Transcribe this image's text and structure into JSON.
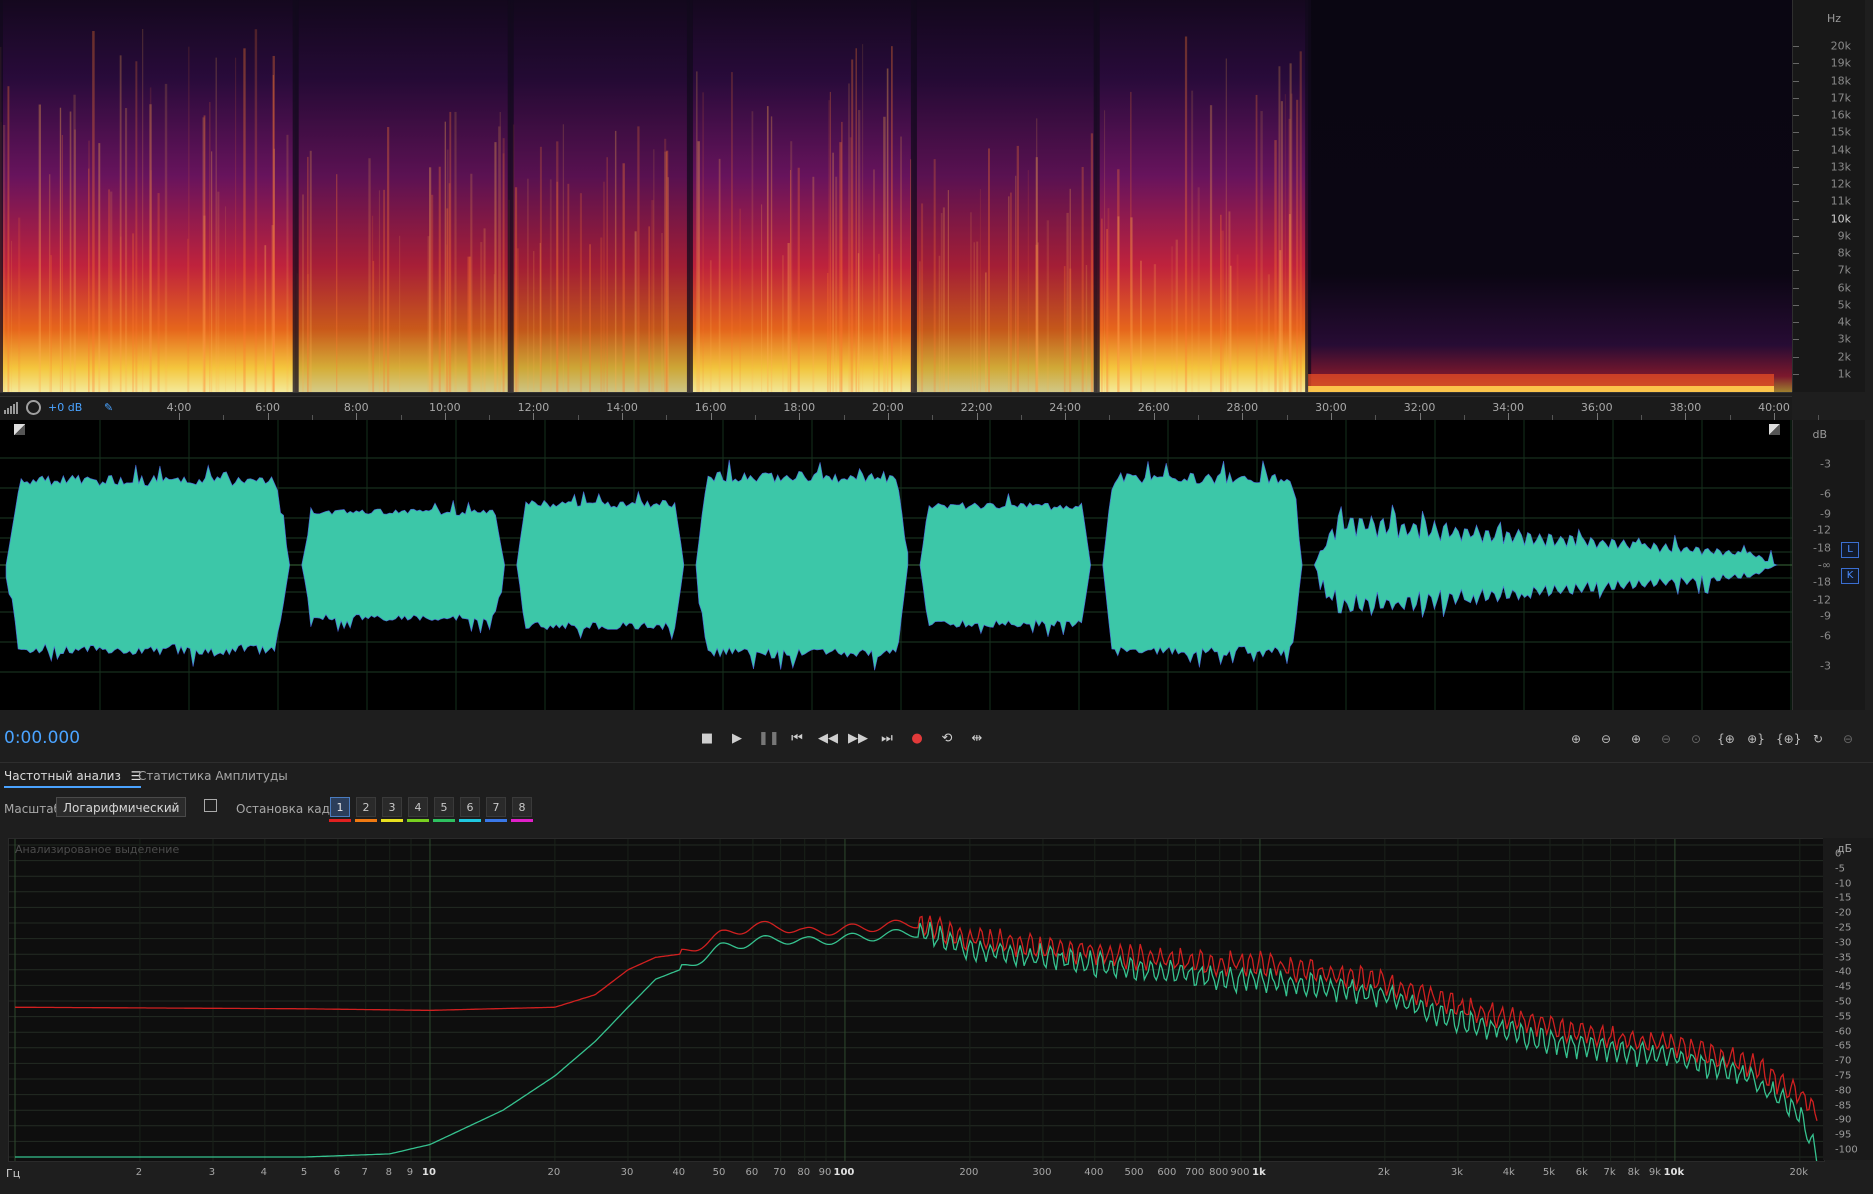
{
  "spectral": {
    "hz_unit": "Hz",
    "hz_labels": [
      "20k",
      "19k",
      "18k",
      "17k",
      "16k",
      "15k",
      "14k",
      "13k",
      "12k",
      "11k",
      "10k",
      "9k",
      "8k",
      "7k",
      "6k",
      "5k",
      "4k",
      "3k",
      "2k",
      "1k"
    ],
    "bright_label": "10k",
    "segments": [
      {
        "start": 0.0,
        "end": 0.165,
        "energy": 0.9
      },
      {
        "start": 0.165,
        "end": 0.285,
        "energy": 0.62
      },
      {
        "start": 0.285,
        "end": 0.385,
        "energy": 0.55
      },
      {
        "start": 0.385,
        "end": 0.51,
        "energy": 0.88
      },
      {
        "start": 0.51,
        "end": 0.612,
        "energy": 0.58
      },
      {
        "start": 0.612,
        "end": 0.73,
        "energy": 0.9
      },
      {
        "start": 0.73,
        "end": 1.0,
        "energy": 0.12
      }
    ]
  },
  "time_ruler": {
    "gain_label": "+0 dB",
    "ticks": [
      "4:00",
      "6:00",
      "8:00",
      "10:00",
      "12:00",
      "14:00",
      "16:00",
      "18:00",
      "20:00",
      "22:00",
      "24:00",
      "26:00",
      "28:00",
      "30:00",
      "32:00",
      "34:00",
      "36:00",
      "38:00",
      "40:00"
    ]
  },
  "waveform": {
    "color": "#3cc7a8",
    "db_unit": "dB",
    "db_labels_top": [
      "-3",
      "-6",
      "-9",
      "-12",
      "-18",
      "-∞"
    ],
    "db_labels_bottom": [
      "-18",
      "-12",
      "-9",
      "-6",
      "-3"
    ],
    "channel_left": "L",
    "channel_right": "K"
  },
  "transport": {
    "time": "0:00.000",
    "record_color": "#e23a3a"
  },
  "tabs": {
    "frequency": "Частотный анализ",
    "amplitude": "Статистика Амплитуды"
  },
  "controls": {
    "scale_label": "Масштаб:",
    "scale_value": "Логарифмический",
    "freeze_label": "Остановка кадра:",
    "frames": [
      "1",
      "2",
      "3",
      "4",
      "5",
      "6",
      "7",
      "8"
    ],
    "frame_colors": [
      "#e02020",
      "#f07a12",
      "#e8e020",
      "#78d020",
      "#2ec060",
      "#20c8e0",
      "#3a78e8",
      "#e020c8"
    ]
  },
  "freq_analysis": {
    "subtitle": "Анализированое выделение",
    "db_unit": "дБ",
    "db_labels": [
      "0",
      "-5",
      "-10",
      "-15",
      "-20",
      "-25",
      "-30",
      "-35",
      "-40",
      "-45",
      "-50",
      "-55",
      "-60",
      "-65",
      "-70",
      "-75",
      "-80",
      "-85",
      "-90",
      "-95",
      "-100"
    ],
    "hz_unit": "Гц",
    "hz_labels": [
      {
        "v": 2,
        "t": "2"
      },
      {
        "v": 3,
        "t": "3"
      },
      {
        "v": 4,
        "t": "4"
      },
      {
        "v": 5,
        "t": "5"
      },
      {
        "v": 6,
        "t": "6"
      },
      {
        "v": 7,
        "t": "7"
      },
      {
        "v": 8,
        "t": "8"
      },
      {
        "v": 9,
        "t": "9"
      },
      {
        "v": 10,
        "t": "10",
        "bold": true
      },
      {
        "v": 20,
        "t": "20"
      },
      {
        "v": 30,
        "t": "30"
      },
      {
        "v": 40,
        "t": "40"
      },
      {
        "v": 50,
        "t": "50"
      },
      {
        "v": 60,
        "t": "60"
      },
      {
        "v": 70,
        "t": "70"
      },
      {
        "v": 80,
        "t": "80"
      },
      {
        "v": 90,
        "t": "90"
      },
      {
        "v": 100,
        "t": "100",
        "bold": true
      },
      {
        "v": 200,
        "t": "200"
      },
      {
        "v": 300,
        "t": "300"
      },
      {
        "v": 400,
        "t": "400"
      },
      {
        "v": 500,
        "t": "500"
      },
      {
        "v": 600,
        "t": "600"
      },
      {
        "v": 700,
        "t": "700"
      },
      {
        "v": 800,
        "t": "800"
      },
      {
        "v": 900,
        "t": "900"
      },
      {
        "v": 1000,
        "t": "1k",
        "bold": true
      },
      {
        "v": 2000,
        "t": "2k"
      },
      {
        "v": 3000,
        "t": "3k"
      },
      {
        "v": 4000,
        "t": "4k"
      },
      {
        "v": 5000,
        "t": "5k"
      },
      {
        "v": 6000,
        "t": "6k"
      },
      {
        "v": 7000,
        "t": "7k"
      },
      {
        "v": 8000,
        "t": "8k"
      },
      {
        "v": 9000,
        "t": "9k"
      },
      {
        "v": 10000,
        "t": "10k",
        "bold": true
      },
      {
        "v": 20000,
        "t": "20k"
      }
    ],
    "red_curve": [
      [
        1,
        -52
      ],
      [
        5,
        -52.5
      ],
      [
        10,
        -53
      ],
      [
        20,
        -52
      ],
      [
        25,
        -48
      ],
      [
        30,
        -40
      ],
      [
        35,
        -36
      ],
      [
        40,
        -35
      ],
      [
        50,
        -29
      ],
      [
        60,
        -26
      ],
      [
        70,
        -26
      ],
      [
        80,
        -28
      ],
      [
        100,
        -27
      ],
      [
        150,
        -25
      ],
      [
        200,
        -30
      ],
      [
        300,
        -33
      ],
      [
        500,
        -36
      ],
      [
        800,
        -38
      ],
      [
        1000,
        -38
      ],
      [
        2000,
        -44
      ],
      [
        3000,
        -52
      ],
      [
        5000,
        -58
      ],
      [
        7000,
        -62
      ],
      [
        10000,
        -64
      ],
      [
        15000,
        -70
      ],
      [
        20000,
        -80
      ],
      [
        22000,
        -86
      ]
    ],
    "green_curve": [
      [
        1,
        -100
      ],
      [
        5,
        -100
      ],
      [
        8,
        -99
      ],
      [
        10,
        -96
      ],
      [
        15,
        -85
      ],
      [
        20,
        -74
      ],
      [
        25,
        -63
      ],
      [
        30,
        -52
      ],
      [
        35,
        -43
      ],
      [
        40,
        -40
      ],
      [
        50,
        -33
      ],
      [
        60,
        -31
      ],
      [
        70,
        -30
      ],
      [
        80,
        -31
      ],
      [
        100,
        -30
      ],
      [
        150,
        -28
      ],
      [
        200,
        -33
      ],
      [
        300,
        -36
      ],
      [
        500,
        -40
      ],
      [
        800,
        -43
      ],
      [
        1000,
        -43
      ],
      [
        2000,
        -48
      ],
      [
        3000,
        -56
      ],
      [
        5000,
        -63
      ],
      [
        7000,
        -66
      ],
      [
        10000,
        -68
      ],
      [
        15000,
        -74
      ],
      [
        20000,
        -86
      ],
      [
        22000,
        -100
      ]
    ],
    "red_color": "#d02020",
    "green_color": "#36c28f"
  }
}
